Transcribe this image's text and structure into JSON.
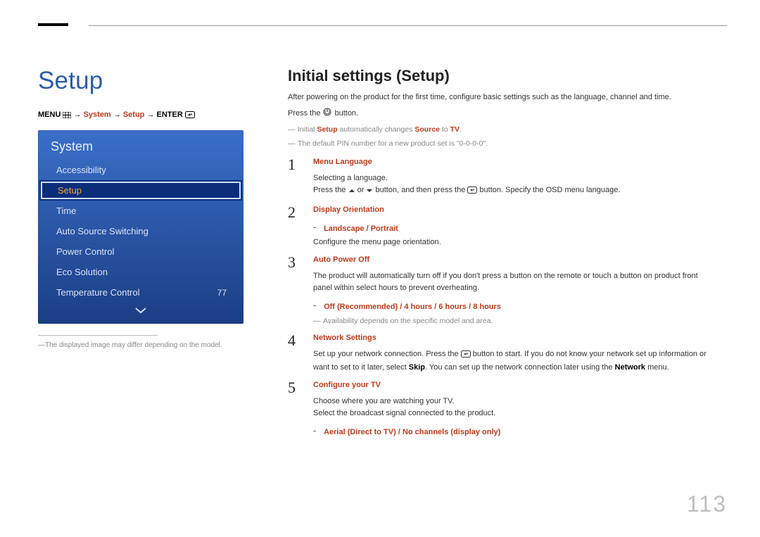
{
  "page_number": "113",
  "left": {
    "title": "Setup",
    "breadcrumb": {
      "menu": "MENU",
      "arrow": "→",
      "system": "System",
      "setup": "Setup",
      "enter": "ENTER"
    },
    "panel": {
      "header": "System",
      "items": [
        {
          "label": "Accessibility",
          "value": "",
          "selected": false
        },
        {
          "label": "Setup",
          "value": "",
          "selected": true
        },
        {
          "label": "Time",
          "value": "",
          "selected": false
        },
        {
          "label": "Auto Source Switching",
          "value": "",
          "selected": false
        },
        {
          "label": "Power Control",
          "value": "",
          "selected": false
        },
        {
          "label": "Eco Solution",
          "value": "",
          "selected": false
        },
        {
          "label": "Temperature Control",
          "value": "77",
          "selected": false
        }
      ]
    },
    "disclaimer": "The displayed image may differ depending on the model."
  },
  "right": {
    "title": "Initial settings (Setup)",
    "intro": "After powering on the product for the first time, configure basic settings such as the language, channel and time.",
    "press_prefix": "Press the",
    "press_suffix": "button.",
    "note1_a": "Initial ",
    "note1_b": "Setup",
    "note1_c": " automatically changes ",
    "note1_d": "Source",
    "note1_e": " to ",
    "note1_f": "TV",
    "note1_g": ".",
    "note2": "The default PIN number for a new product set is \"0-0-0-0\".",
    "steps": [
      {
        "num": "1",
        "title": "Menu Language",
        "lines": [
          "Selecting a language.",
          "PRESS_LINE"
        ],
        "press_text_a": "Press the ",
        "press_text_b": " or ",
        "press_text_c": " button, and then press the ",
        "press_text_d": " button. Specify the OSD menu language."
      },
      {
        "num": "2",
        "title": "Display Orientation",
        "options": [
          "Landscape",
          "Portrait"
        ],
        "lines": [
          "Configure the menu page orientation."
        ]
      },
      {
        "num": "3",
        "title": "Auto Power Off",
        "lines": [
          "The product will automatically turn off if you don't press a button on the remote or touch a button on product front panel within select hours to prevent overheating."
        ],
        "options": [
          "Off (Recommended)",
          "4 hours",
          "6 hours",
          "8 hours"
        ],
        "afternote": "Availability depends on the specific model and area."
      },
      {
        "num": "4",
        "title": "Network Settings",
        "net_a": "Set up your network connection. Press the ",
        "net_b": " button to start. If you do not know your network set up information or want to set to it later, select ",
        "net_skip": "Skip",
        "net_c": ". You can set up the network connection later using the ",
        "net_network": "Network",
        "net_d": " menu."
      },
      {
        "num": "5",
        "title": "Configure your TV",
        "lines": [
          "Choose where you are watching your TV.",
          "Select the broadcast signal connected to the product."
        ],
        "options": [
          "Aerial (Direct to TV)",
          "No channels (display only)"
        ]
      }
    ]
  }
}
